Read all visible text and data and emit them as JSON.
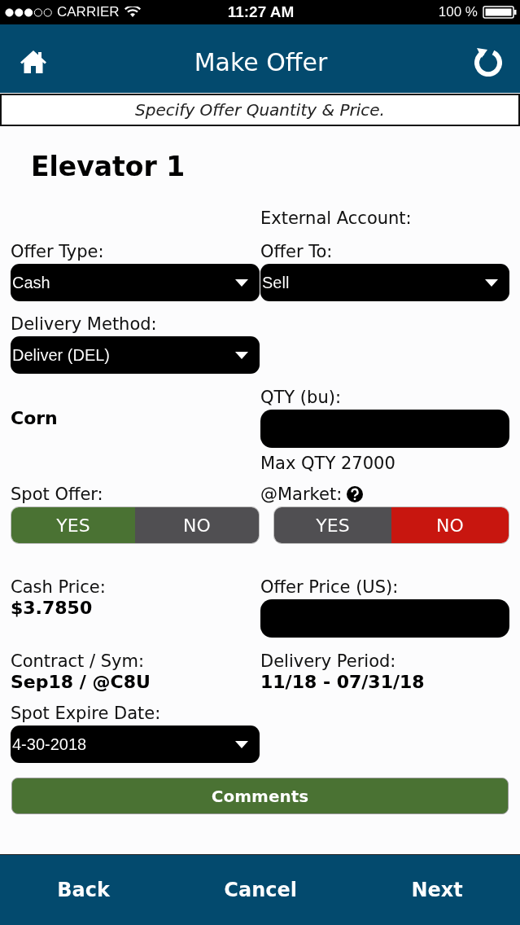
{
  "status_bar": {
    "carrier": "CARRIER",
    "time": "11:27 AM",
    "battery": "100 %"
  },
  "header": {
    "title": "Make Offer"
  },
  "subtitle": "Specify Offer Quantity & Price.",
  "location": "Elevator 1",
  "rows": [
    {
      "left": null,
      "right": {
        "kind": "label",
        "label": "External Account:"
      }
    },
    {
      "left": {
        "kind": "select",
        "label": "Offer Type:",
        "value": "Cash"
      },
      "right": {
        "kind": "select",
        "label": "Offer To:",
        "value": "Sell"
      }
    },
    {
      "left": {
        "kind": "select",
        "label": "Delivery Method:",
        "value": "Deliver (DEL)"
      },
      "right": null
    },
    {
      "left": {
        "kind": "text",
        "value": "Corn"
      },
      "right": {
        "kind": "input",
        "label": "QTY (bu):",
        "note": "Max QTY 27000"
      }
    },
    {
      "left": {
        "kind": "toggle",
        "label": "Spot Offer:",
        "color": "#4a7233",
        "options": [
          {
            "label": "YES",
            "selected": true
          },
          {
            "label": "NO",
            "selected": false
          }
        ]
      },
      "right": {
        "kind": "toggle",
        "label": "@Market:",
        "help": true,
        "color": "#c8160f",
        "options": [
          {
            "label": "YES",
            "selected": false
          },
          {
            "label": "NO",
            "selected": true
          }
        ]
      }
    },
    {
      "left": {
        "kind": "readout",
        "label": "Cash Price:",
        "value": "$3.7850"
      },
      "right": {
        "kind": "input",
        "label": "Offer Price (US):"
      }
    },
    {
      "left": {
        "kind": "readout",
        "label": "Contract / Sym:",
        "value": "Sep18 / @C8U"
      },
      "right": {
        "kind": "readout",
        "label": "Delivery Period:",
        "value": "11/18 - 07/31/18"
      }
    },
    {
      "left": {
        "kind": "select",
        "label": "Spot Expire Date:",
        "value": "4-30-2018"
      },
      "right": null
    }
  ],
  "comments_button": "Comments",
  "footer": [
    "Back",
    "Cancel",
    "Next"
  ]
}
